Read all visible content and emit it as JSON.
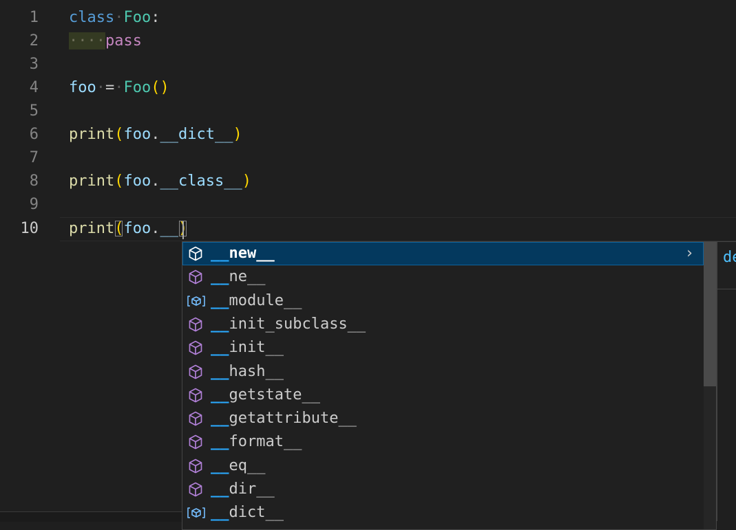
{
  "editor": {
    "lines": [
      {
        "n": "1"
      },
      {
        "n": "2"
      },
      {
        "n": "3"
      },
      {
        "n": "4"
      },
      {
        "n": "5"
      },
      {
        "n": "6"
      },
      {
        "n": "7"
      },
      {
        "n": "8"
      },
      {
        "n": "9"
      },
      {
        "n": "10"
      }
    ],
    "tokens": {
      "l1": {
        "kw": "class",
        "ws": "·",
        "cls": "Foo",
        "colon": ":"
      },
      "l2": {
        "indent": "····",
        "kw": "pass"
      },
      "l4": {
        "var": "foo",
        "ws1": "·",
        "eq": "=",
        "ws2": "·",
        "cls": "Foo",
        "open": "(",
        "close": ")"
      },
      "l6": {
        "fn": "print",
        "open": "(",
        "obj": "foo",
        "dot": ".",
        "attr": "__dict__",
        "close": ")"
      },
      "l8": {
        "fn": "print",
        "open": "(",
        "obj": "foo",
        "dot": ".",
        "attr": "__class__",
        "close": ")"
      },
      "l10": {
        "fn": "print",
        "open": "(",
        "obj": "foo",
        "dot": ".",
        "typed": "__",
        "close": ")"
      }
    }
  },
  "suggest": {
    "items": [
      {
        "hl": "__",
        "rest": "new__",
        "icon": "method-cube-icon"
      },
      {
        "hl": "__",
        "rest": "ne__",
        "icon": "method-cube-icon"
      },
      {
        "hl": "__",
        "rest": "module__",
        "icon": "variable-icon"
      },
      {
        "hl": "__",
        "rest": "init_subclass__",
        "icon": "method-cube-icon"
      },
      {
        "hl": "__",
        "rest": "init__",
        "icon": "method-cube-icon"
      },
      {
        "hl": "__",
        "rest": "hash__",
        "icon": "method-cube-icon"
      },
      {
        "hl": "__",
        "rest": "getstate__",
        "icon": "method-cube-icon"
      },
      {
        "hl": "__",
        "rest": "getattribute__",
        "icon": "method-cube-icon"
      },
      {
        "hl": "__",
        "rest": "format__",
        "icon": "method-cube-icon"
      },
      {
        "hl": "__",
        "rest": "eq__",
        "icon": "method-cube-icon"
      },
      {
        "hl": "__",
        "rest": "dir__",
        "icon": "method-cube-icon"
      },
      {
        "hl": "__",
        "rest": "dict__",
        "icon": "variable-icon"
      }
    ],
    "chevron": "›",
    "details_text": "de"
  },
  "colors": {
    "background": "#1f1f1f",
    "selected_item": "#04395e",
    "match_highlight": "#2aaaff",
    "method_icon": "#b180d7",
    "variable_icon": "#75beff"
  }
}
